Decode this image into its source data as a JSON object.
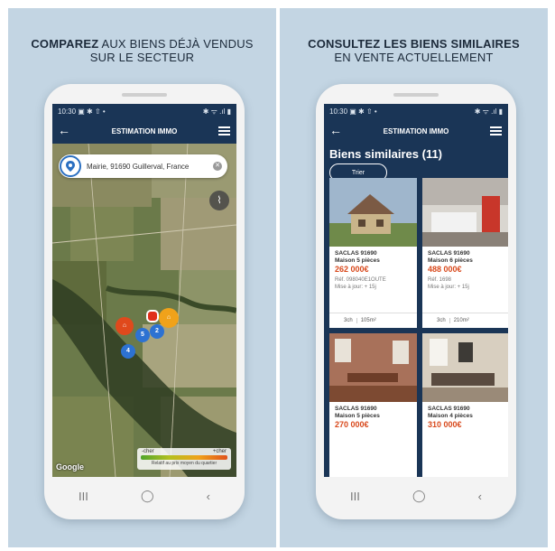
{
  "left": {
    "heading_bold": "COMPAREZ",
    "heading_rest": "AUX BIENS DÉJÀ VENDUS",
    "heading_line2": "SUR LE SECTEUR",
    "status_time": "10:30",
    "status_icons_left": "▣ ✱ ⇧ •",
    "status_icons_right": "✱ ᯤ .ıl ▮",
    "app_title": "ESTIMATION IMMO",
    "search_value": "Mairie, 91690 Guillerval, France",
    "markers": [
      "5",
      "2",
      "4"
    ],
    "legend_low": "-cher",
    "legend_high": "+cher",
    "legend_note": "Relatif au prix moyen du quartier",
    "map_attribution": "Google"
  },
  "right": {
    "heading_bold": "CONSULTEZ LES BIENS SIMILAIRES",
    "heading_line2": "EN VENTE ACTUELLEMENT",
    "status_time": "10:30",
    "status_icons_left": "▣ ✱ ⇧ •",
    "status_icons_right": "✱ ᯤ .ıl ▮",
    "app_title": "ESTIMATION IMMO",
    "list_title": "Biens similaires (11)",
    "sort_label": "Trier",
    "cards": [
      {
        "city": "SACLAS 91690",
        "type": "Maison 5 pièces",
        "price": "262 000€",
        "ref": "Réf. 098040E1OUTE",
        "updated": "Mise à jour: + 15j",
        "rooms": "3ch",
        "area": "105m²"
      },
      {
        "city": "SACLAS 91690",
        "type": "Maison 6 pièces",
        "price": "488 000€",
        "ref": "Réf. 1698",
        "updated": "Mise à jour: + 15j",
        "rooms": "3ch",
        "area": "210m²"
      },
      {
        "city": "SACLAS 91690",
        "type": "Maison 5 pièces",
        "price": "270 000€",
        "ref": "",
        "updated": "",
        "rooms": "",
        "area": ""
      },
      {
        "city": "SACLAS 91690",
        "type": "Maison 4 pièces",
        "price": "310 000€",
        "ref": "",
        "updated": "",
        "rooms": "",
        "area": ""
      }
    ]
  },
  "nav": {
    "recents": "III",
    "home": "◯",
    "back": "‹"
  },
  "colors": {
    "navy": "#1a3556",
    "price": "#d8481b",
    "panel_bg": "#c3d5e3"
  }
}
